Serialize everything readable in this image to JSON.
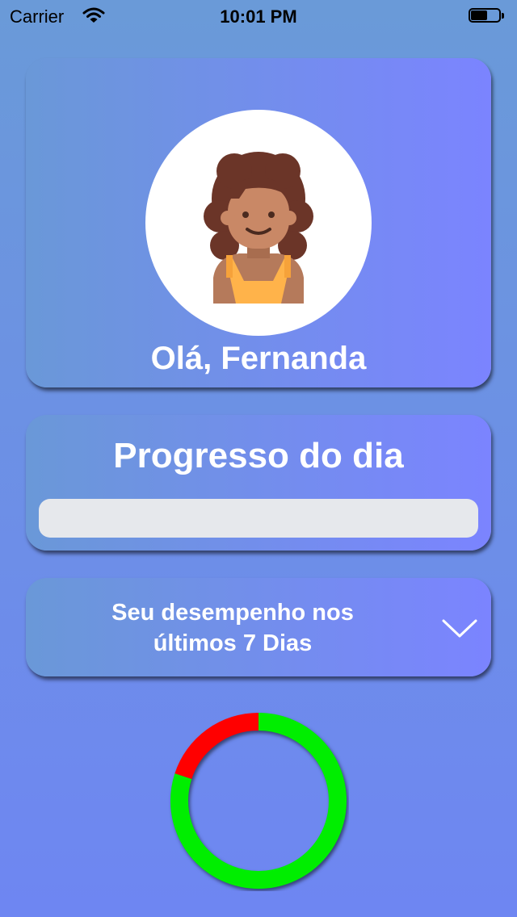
{
  "status_bar": {
    "carrier": "Carrier",
    "time": "10:01 PM",
    "battery_level": 0.6
  },
  "profile": {
    "greeting": "Olá, Fernanda",
    "avatar_icon": "girl-avatar-icon"
  },
  "daily_progress": {
    "title": "Progresso do dia",
    "value": 0
  },
  "performance": {
    "title_line1": "Seu desempenho nos",
    "title_line2": "últimos 7 Dias",
    "toggle_icon": "chevron-down-icon"
  },
  "chart_data": {
    "type": "pie",
    "style": "donut",
    "slices": [
      {
        "value": 80,
        "color": "#00ee00"
      },
      {
        "value": 20,
        "color": "#ff0000"
      }
    ]
  },
  "colors": {
    "card_gradient_start": "#6a98d8",
    "card_gradient_end": "#7b84ff",
    "progress_track": "#e6e8ec",
    "chart_correct": "#00ee00",
    "chart_wrong": "#ff0000"
  }
}
